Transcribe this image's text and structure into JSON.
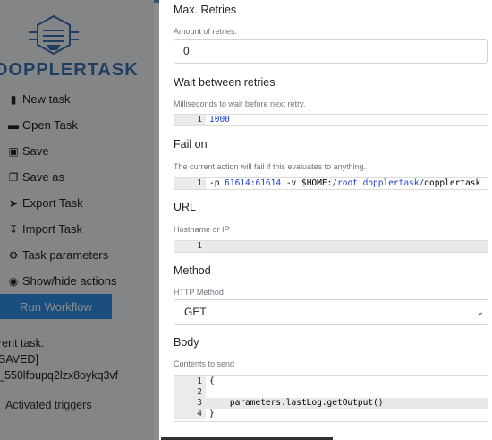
{
  "sidebar": {
    "logo_text": "DOPPLERTASK",
    "items": [
      {
        "label": "New task",
        "icon": "file-icon"
      },
      {
        "label": "Open Task",
        "icon": "folder-open-icon"
      },
      {
        "label": "Save",
        "icon": "save-icon"
      },
      {
        "label": "Save as",
        "icon": "copy-icon"
      },
      {
        "label": "Export Task",
        "icon": "export-icon"
      },
      {
        "label": "Import Task",
        "icon": "import-icon"
      },
      {
        "label": "Task parameters",
        "icon": "gear-icon"
      },
      {
        "label": "Show/hide actions",
        "icon": "toggle-icon"
      }
    ],
    "run_label": "Run Workflow",
    "current_task_label": "rent task:",
    "current_task_status": "SAVED]",
    "current_task_id": "_550lfbupq2lzx8oykq3vf",
    "triggers_label": "Activated triggers"
  },
  "form": {
    "max_retries": {
      "label": "Max. Retries",
      "help": "Amount of retries.",
      "value": "0"
    },
    "wait": {
      "label": "Wait between retries",
      "help": "Milliseconds to wait before next retry.",
      "line_no": "1",
      "value": "1000"
    },
    "fail_on": {
      "label": "Fail on",
      "help": "The current action will fail if this evaluates to anything.",
      "line_no": "1",
      "seg1": "-p ",
      "seg2": "61614:61614",
      "seg3": " -v $HOME:",
      "seg4": "/root dopplertask/",
      "seg5": "dopplertask"
    },
    "url": {
      "label": "URL",
      "help": "Hostname or IP",
      "line_no": "1",
      "value": ""
    },
    "method": {
      "label": "Method",
      "help": "HTTP Method",
      "value": "GET"
    },
    "body": {
      "label": "Body",
      "help": "Contents to send",
      "lines": [
        {
          "no": "1",
          "text": "{"
        },
        {
          "no": "2",
          "text": ""
        },
        {
          "no": "3",
          "text": "    parameters.lastLog.getOutput()"
        },
        {
          "no": "4",
          "text": "}"
        }
      ]
    }
  },
  "colors": {
    "accent": "#2f8fe8",
    "logo": "#3a6fb0",
    "topbar": "#5b9bd5"
  }
}
